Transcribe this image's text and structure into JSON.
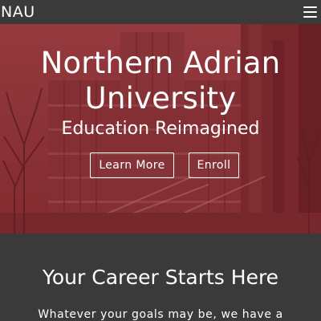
{
  "navbar": {
    "brand": "NAU",
    "menu_icon": "hamburger-menu-icon"
  },
  "hero": {
    "title_line1": "Northern Adrian",
    "title_line2": "University",
    "subtitle": "Education Reimagined",
    "learn_more_label": "Learn More",
    "enroll_label": "Enroll",
    "overlay_color": "#8b2f33"
  },
  "career": {
    "title": "Your Career Starts Here",
    "text": "Whatever your goals may be, we have a"
  },
  "colors": {
    "navbar_bg": "#3b3a3a",
    "section_bg": "#3a3a3a",
    "text": "#ffffff"
  }
}
